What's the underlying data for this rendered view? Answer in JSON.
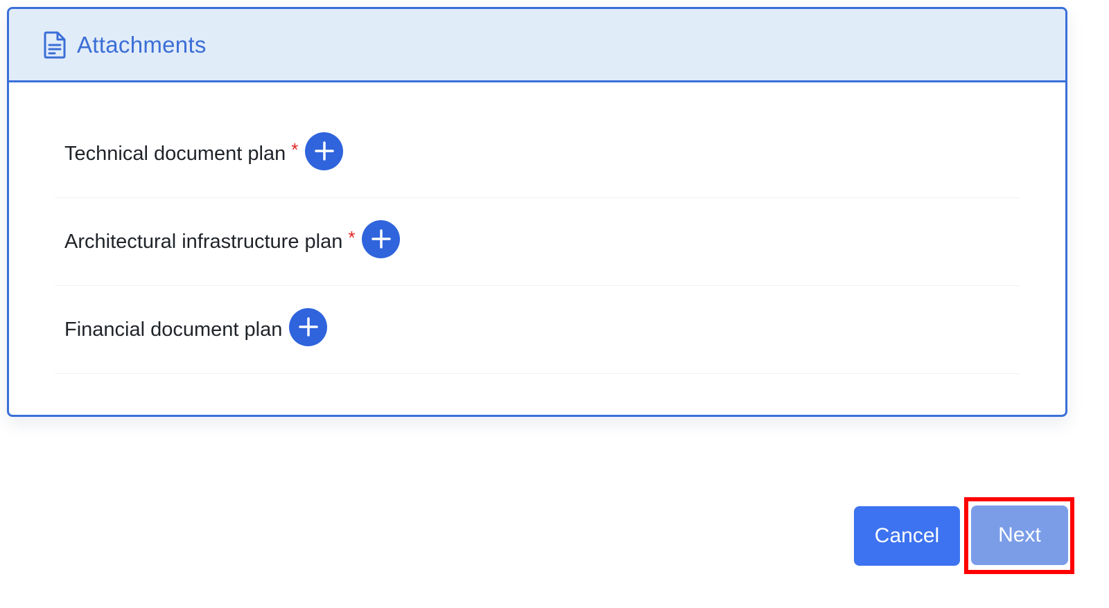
{
  "panel": {
    "title": "Attachments",
    "icon": "document-icon",
    "items": [
      {
        "label": "Technical document plan",
        "required": true,
        "required_mark": "*"
      },
      {
        "label": "Architectural infrastructure plan",
        "required": true,
        "required_mark": "*"
      },
      {
        "label": "Financial document plan",
        "required": false,
        "required_mark": ""
      }
    ]
  },
  "actions": {
    "cancel_label": "Cancel",
    "next_label": "Next"
  },
  "colors": {
    "accent": "#3a6fd8",
    "header_bg": "#e1ecf9",
    "add_button": "#2f64dc",
    "required": "#e02424",
    "cancel_button": "#3d73f0",
    "next_button": "#7b9de8",
    "highlight": "#ff0000"
  }
}
